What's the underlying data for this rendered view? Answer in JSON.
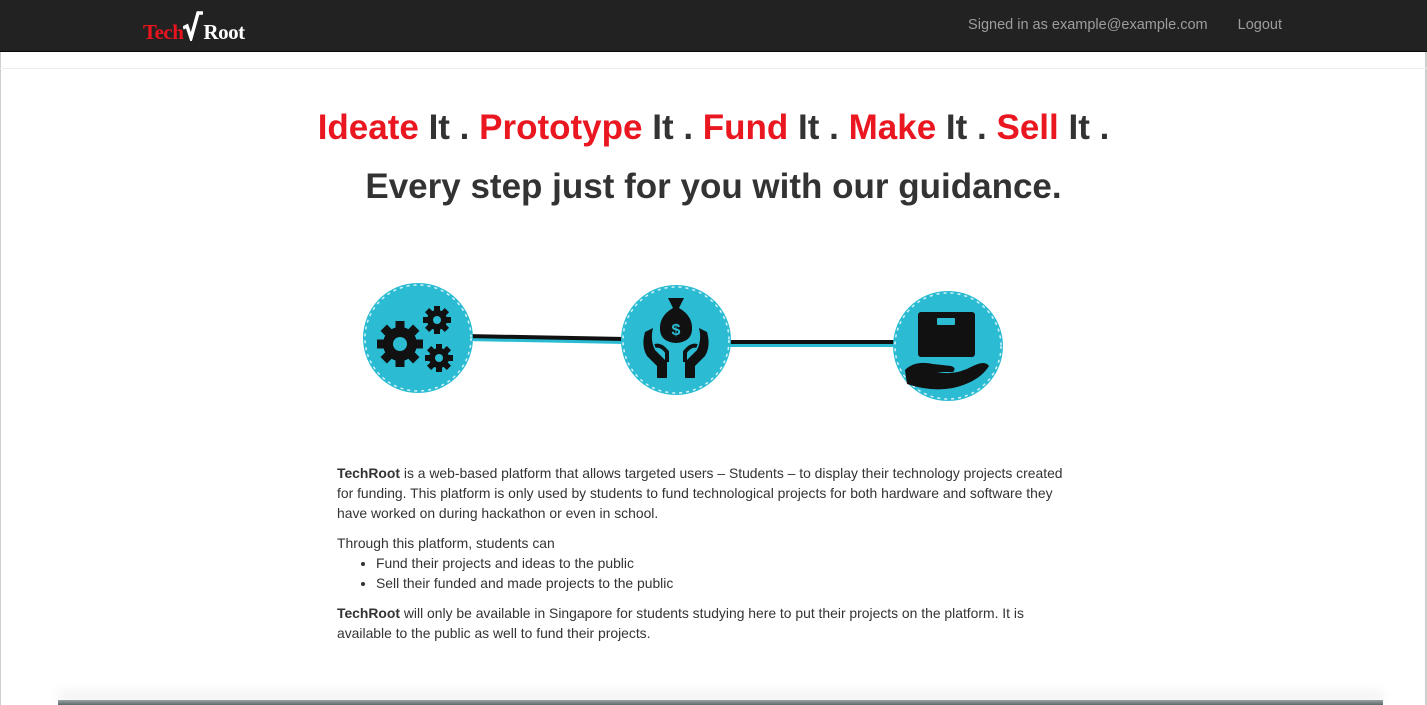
{
  "navbar": {
    "brand_part1": "Tech",
    "brand_part2": "Root",
    "signed_in_text": "Signed in as example@example.com",
    "logout_label": "Logout"
  },
  "hero": {
    "words": [
      {
        "highlight": "Ideate",
        "rest": " It ."
      },
      {
        "highlight": "Prototype",
        "rest": " It ."
      },
      {
        "highlight": "Fund",
        "rest": " It ."
      },
      {
        "highlight": "Make",
        "rest": " It ."
      },
      {
        "highlight": "Sell",
        "rest": " It ."
      }
    ],
    "subheading": "Every step just for you with our guidance."
  },
  "process_icons": [
    "gears-icon",
    "money-bag-hands-icon",
    "box-hand-icon"
  ],
  "about": {
    "p1_brand": "TechRoot",
    "p1_text": " is a web-based platform that allows targeted users – Students – to display their technology projects created for funding. This platform is only used by students to fund technological projects for both hardware and software they have worked on during hackathon or even in school.",
    "p2_text": "Through this platform, students can",
    "list": [
      "Fund their projects and ideas to the public",
      "Sell their funded and made projects to the public"
    ],
    "p3_brand": "TechRoot",
    "p3_text": " will only be available in Singapore for students studying here to put their projects on the platform. It is available to the public as well to fund their projects."
  },
  "colors": {
    "navbar_bg": "#222222",
    "accent_red": "#ea1620",
    "icon_teal": "#2bbcd4"
  }
}
